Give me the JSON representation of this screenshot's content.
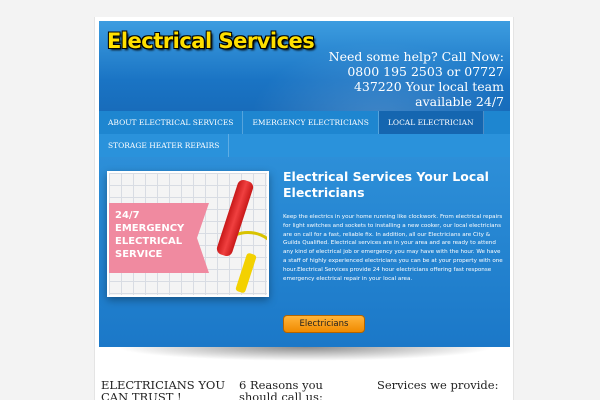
{
  "header": {
    "logo": "Electrical Services",
    "callout": "Need some help? Call Now: 0800 195 2503 or 07727 437220 Your local team available 24/7"
  },
  "nav": {
    "items": [
      {
        "label": "ABOUT ELECTRICAL SERVICES"
      },
      {
        "label": "EMERGENCY ELECTRICIANS"
      },
      {
        "label": "LOCAL ELECTRICIAN"
      },
      {
        "label": "STORAGE HEATER REPAIRS"
      }
    ],
    "active_index": 2
  },
  "hero": {
    "image_text": "24/7 EMERGENCY ELECTRICAL SERVICE",
    "title": "Electrical Services Your Local Electricians",
    "body": "Keep the electrics in your home running like clockwork. From electrical repairs for light switches and sockets to installing a new cooker, our local electricians are on call for a fast, reliable fix. In addition, all our Electricians are City & Guilds Qualified. Electrical services are in your area and are ready to attend any kind of electrical job or emergency you may have with the hour. We have a staff of highly experienced electricians you can be at your property with one hour.Electrical Services provide 24 hour electricians offering fast response emergency electrical repair in your local area.",
    "button_label": "Electricians"
  },
  "columns": [
    {
      "title": "ELECTRICIANS YOU CAN TRUST !"
    },
    {
      "title": "6 Reasons you should call us:"
    },
    {
      "title": "Services we provide:"
    }
  ],
  "colors": {
    "header_blue": "#1a74c4",
    "logo_yellow": "#ffe000",
    "button_orange": "#f08a00"
  }
}
